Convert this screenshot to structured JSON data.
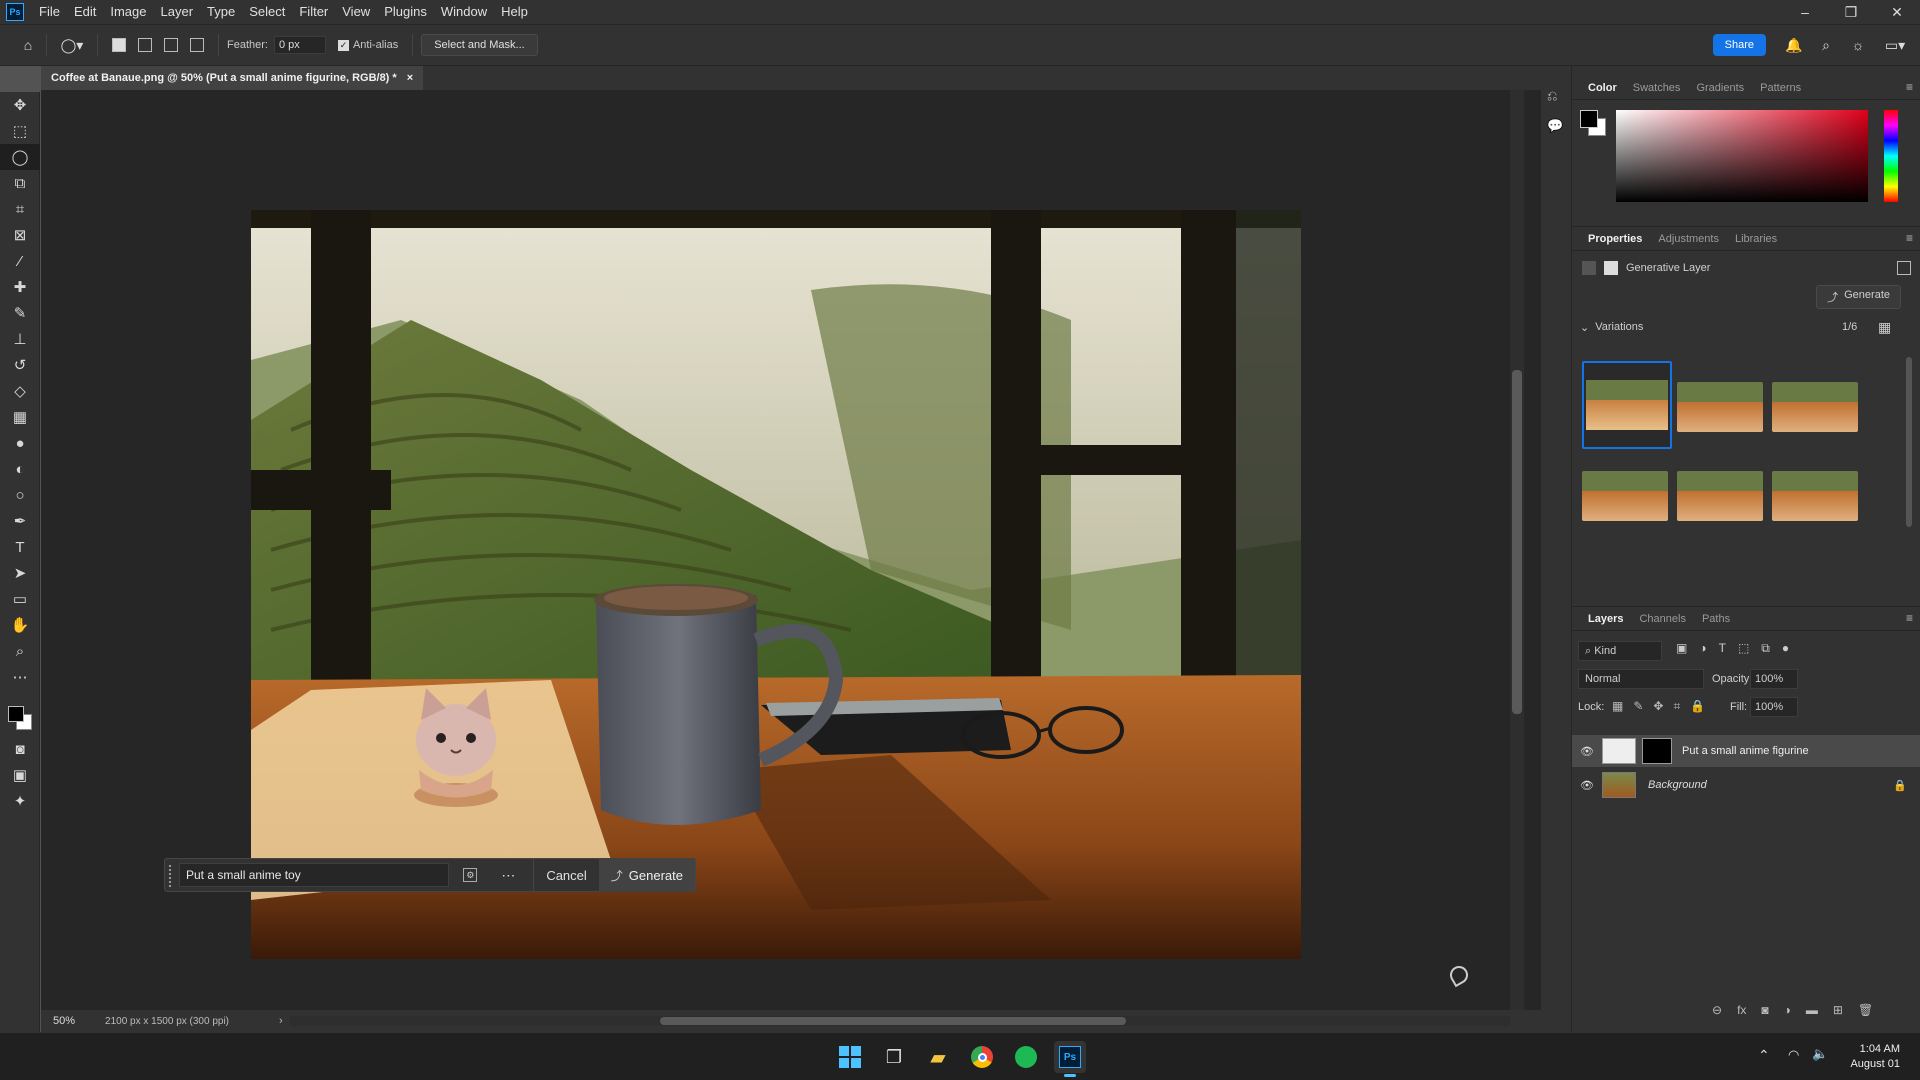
{
  "app": {
    "logo": "Ps"
  },
  "menu": [
    "File",
    "Edit",
    "Image",
    "Layer",
    "Type",
    "Select",
    "Filter",
    "View",
    "Plugins",
    "Window",
    "Help"
  ],
  "window_controls": {
    "minimize": "–",
    "restore": "❐",
    "close": "✕"
  },
  "options": {
    "feather_label": "Feather:",
    "feather_value": "0 px",
    "antialias_label": "Anti-alias",
    "antialias_checked": true,
    "select_mask_label": "Select and Mask...",
    "share_label": "Share"
  },
  "document": {
    "tab_title": "Coffee at Banaue.png @ 50% (Put a small anime figurine, RGB/8) *",
    "close_glyph": "×",
    "zoom": "50%",
    "dimensions": "2100 px x 1500 px (300 ppi)"
  },
  "context_bar": {
    "prompt_value": "Put a small anime toy",
    "cancel_label": "Cancel",
    "generate_label": "Generate"
  },
  "color_panel": {
    "tabs": [
      "Color",
      "Swatches",
      "Gradients",
      "Patterns"
    ],
    "active": "Color",
    "foreground": "#000000",
    "background": "#ffffff"
  },
  "properties_panel": {
    "tabs": [
      "Properties",
      "Adjustments",
      "Libraries"
    ],
    "active": "Properties",
    "layer_type": "Generative Layer",
    "generate_label": "Generate",
    "variations_label": "Variations",
    "variations_count": "1/6"
  },
  "layers_panel": {
    "tabs": [
      "Layers",
      "Channels",
      "Paths"
    ],
    "active": "Layers",
    "kind_label": "Kind",
    "blend_mode": "Normal",
    "opacity_label": "Opacity:",
    "opacity_value": "100%",
    "lock_label": "Lock:",
    "fill_label": "Fill:",
    "fill_value": "100%",
    "layers": [
      {
        "name": "Put a small anime figurine",
        "selected": true
      },
      {
        "name": "Background",
        "locked": true
      }
    ]
  },
  "taskbar": {
    "time": "1:04 AM",
    "date": "August 01"
  }
}
